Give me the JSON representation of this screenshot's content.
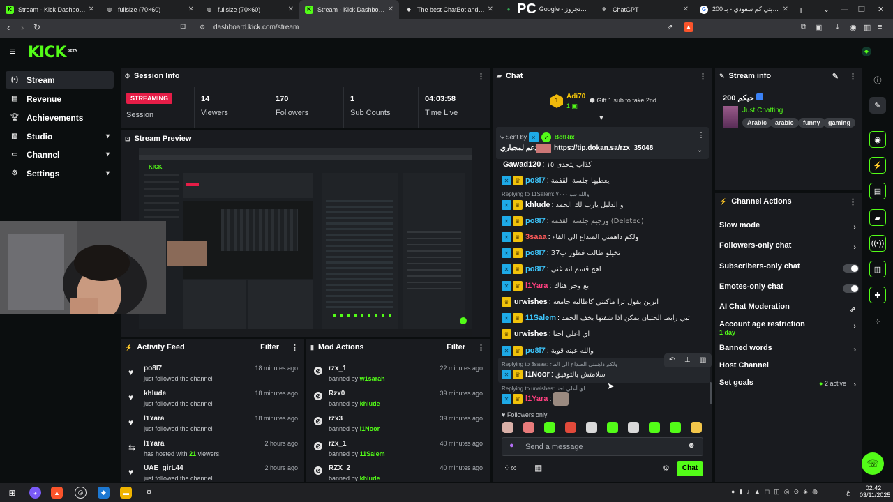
{
  "browser": {
    "tabs": [
      {
        "label": "Stream - Kick Dashboard",
        "icon": "kick-icon",
        "active": false
      },
      {
        "label": "fullsize (70×60)",
        "icon": "globe-icon",
        "active": false
      },
      {
        "label": "fullsize (70×60)",
        "icon": "globe-icon",
        "active": false
      },
      {
        "label": "Stream - Kick Dashboard",
        "icon": "kick-icon",
        "active": true
      },
      {
        "label": "The best ChatBot and Widgets",
        "icon": "botrix-icon",
        "active": false
      },
      {
        "label": "Google - خرائط احتجزوز",
        "icon": "maps-icon",
        "active": false
      },
      {
        "label": "ChatGPT",
        "icon": "openai-icon",
        "active": false
      },
      {
        "label": "200 دينار كويتي كم سعودي - بـ",
        "icon": "google-icon",
        "active": false
      }
    ],
    "overlay_text": "PC",
    "url": "dashboard.kick.com/stream",
    "new_tab": "+"
  },
  "app": {
    "logo": "KICK",
    "logo_beta": "BETA",
    "accent": "#53fc18"
  },
  "nav": [
    {
      "label": "Stream",
      "icon": "stream-icon",
      "selected": true
    },
    {
      "label": "Revenue",
      "icon": "revenue-icon"
    },
    {
      "label": "Achievements",
      "icon": "trophy-icon"
    },
    {
      "label": "Studio",
      "icon": "studio-icon",
      "expandable": true
    },
    {
      "label": "Channel",
      "icon": "channel-icon",
      "expandable": true
    },
    {
      "label": "Settings",
      "icon": "gear-icon",
      "expandable": true
    }
  ],
  "session": {
    "title": "Session Info",
    "status": "STREAMING",
    "status_label": "Session",
    "stats": [
      {
        "value": "14",
        "label": "Viewers"
      },
      {
        "value": "170",
        "label": "Followers"
      },
      {
        "value": "1",
        "label": "Sub Counts"
      },
      {
        "value": "04:03:58",
        "label": "Time Live"
      }
    ]
  },
  "preview": {
    "title": "Stream Preview"
  },
  "activity": {
    "title": "Activity Feed",
    "filter": "Filter",
    "items": [
      {
        "name": "po8l7",
        "desc": "just followed the channel",
        "time": "18 minutes ago",
        "icon": "heart-icon"
      },
      {
        "name": "khlude",
        "desc": "just followed the channel",
        "time": "18 minutes ago",
        "icon": "heart-icon"
      },
      {
        "name": "l1Yara",
        "desc": "just followed the channel",
        "time": "18 minutes ago",
        "icon": "heart-icon"
      },
      {
        "name": "l1Yara",
        "desc_pre": "has hosted with",
        "desc_num": "21",
        "desc_post": "viewers!",
        "time": "2 hours ago",
        "icon": "host-icon"
      },
      {
        "name": "UAE_girL44",
        "desc": "just followed the channel",
        "time": "2 hours ago",
        "icon": "heart-icon"
      }
    ]
  },
  "mod": {
    "title": "Mod Actions",
    "filter": "Filter",
    "banned_by": "banned by",
    "items": [
      {
        "name": "rzx_1",
        "by": "w1sarah",
        "time": "22 minutes ago"
      },
      {
        "name": "Rzx0",
        "by": "khlude",
        "time": "39 minutes ago"
      },
      {
        "name": "rzx3",
        "by": "l1Noor",
        "time": "39 minutes ago"
      },
      {
        "name": "rzx_1",
        "by": "11Salem",
        "time": "40 minutes ago"
      },
      {
        "name": "RZX_2",
        "by": "khlude",
        "time": "40 minutes ago"
      }
    ]
  },
  "chat": {
    "title": "Chat",
    "top_gifter": {
      "rank": "1",
      "name": "Adi70",
      "count": "1",
      "cta": "Gift 1 sub to take 2nd"
    },
    "pinned": {
      "sent_by": "Sent by",
      "bot": "BotRix",
      "user": "الدعم لمجباري",
      "link": "https://tip.dokan.sa/rzx_35048"
    },
    "messages": [
      {
        "name": "Gawad120",
        "text": "كذاب يتحدى ١٥",
        "color": "#ffffff",
        "badges": []
      },
      {
        "name": "po8l7",
        "text": "يعطيها جلسة القفمة",
        "color": "#3ec8ff",
        "badges": [
          "mod",
          "crown"
        ]
      },
      {
        "reply": "Replying to 11Salem: والله سو ٧٠٠٠"
      },
      {
        "name": "khlude",
        "text": "و الدليل يارب لك الحمد",
        "color": "#ffffff",
        "badges": [
          "mod",
          "crown"
        ]
      },
      {
        "name": "po8l7",
        "text": "ورجيم جلسة القفمة (Deleted)",
        "color": "#3ec8ff",
        "badges": [
          "mod",
          "crown"
        ]
      },
      {
        "name": "3saaa",
        "text": "ولكم داهمني الصداع الى القاء",
        "color": "#ff5a5a",
        "badges": [
          "mod",
          "crown"
        ]
      },
      {
        "name": "po8l7",
        "text": "تخيلو طالب فطور ب37",
        "color": "#3ec8ff",
        "badges": [
          "mod",
          "crown"
        ]
      },
      {
        "name": "po8l7",
        "text": "اهج قسم انه غني",
        "color": "#3ec8ff",
        "badges": [
          "mod",
          "crown"
        ]
      },
      {
        "name": "l1Yara",
        "text": "يع وخر هناك",
        "color": "#ff3f7f",
        "badges": [
          "mod",
          "crown"
        ]
      },
      {
        "name": "urwishes",
        "text": "انزين يقول ترا ماكنتي كاطالبة جامعه",
        "color": "#ffffff",
        "badges": [
          "crown"
        ]
      },
      {
        "name": "11Salem",
        "text": "تبي رابط الحتيان يمكن اذا شفتها يخف الحمد",
        "color": "#3ec8ff",
        "badges": [
          "mod",
          "crown"
        ]
      },
      {
        "name": "urwishes",
        "text": "اي أعلي احنا",
        "color": "#ffffff",
        "badges": [
          "crown"
        ]
      },
      {
        "name": "po8l7",
        "text": "والله عينه قوية",
        "color": "#3ec8ff",
        "badges": [
          "mod",
          "crown"
        ]
      },
      {
        "reply": "Replying to 3saaa: ولكم داهمني الصداع الى القاء"
      },
      {
        "name": "l1Noor",
        "text": "سلامتش بالتوفيق",
        "color": "#ffffff",
        "badges": [
          "mod",
          "crown"
        ]
      },
      {
        "reply": "Replying to urwishes: اي أعلي احنا"
      },
      {
        "name": "l1Yara",
        "text": "",
        "color": "#ff3f7f",
        "badges": [
          "mod",
          "crown"
        ],
        "sticker": true
      }
    ],
    "mode": "Followers only",
    "input_placeholder": "Send a message",
    "send": "Chat",
    "emote_colors": [
      "#d9b0a8",
      "#e87b7b",
      "#53fc18",
      "#e24a3b",
      "#d9d9d9",
      "#53fc18",
      "#d9d9d9",
      "#53fc18",
      "#53fc18",
      "#f3c64a"
    ]
  },
  "stream_info": {
    "title": "Stream info",
    "stream_title": "200 حيكم",
    "category": "Just Chatting",
    "tags": [
      "Arabic",
      "arabic",
      "funny",
      "gaming"
    ]
  },
  "channel_actions": {
    "title": "Channel Actions",
    "items": [
      {
        "label": "Slow mode",
        "type": "chevron"
      },
      {
        "label": "Followers-only chat",
        "type": "chevron"
      },
      {
        "label": "Subscribers-only chat",
        "type": "toggle"
      },
      {
        "label": "Emotes-only chat",
        "type": "toggle"
      },
      {
        "label": "AI Chat Moderation",
        "type": "external"
      },
      {
        "label": "Account age restriction",
        "sub": "1 day",
        "type": "chevron"
      },
      {
        "label": "Banned words",
        "type": "chevron"
      },
      {
        "label": "Host Channel",
        "type": "none"
      },
      {
        "label": "Set goals",
        "sub_right": "2 active",
        "type": "chevron"
      }
    ]
  },
  "taskbar": {
    "time": "02:42",
    "date": "03/11/2025",
    "lang": "ع"
  }
}
